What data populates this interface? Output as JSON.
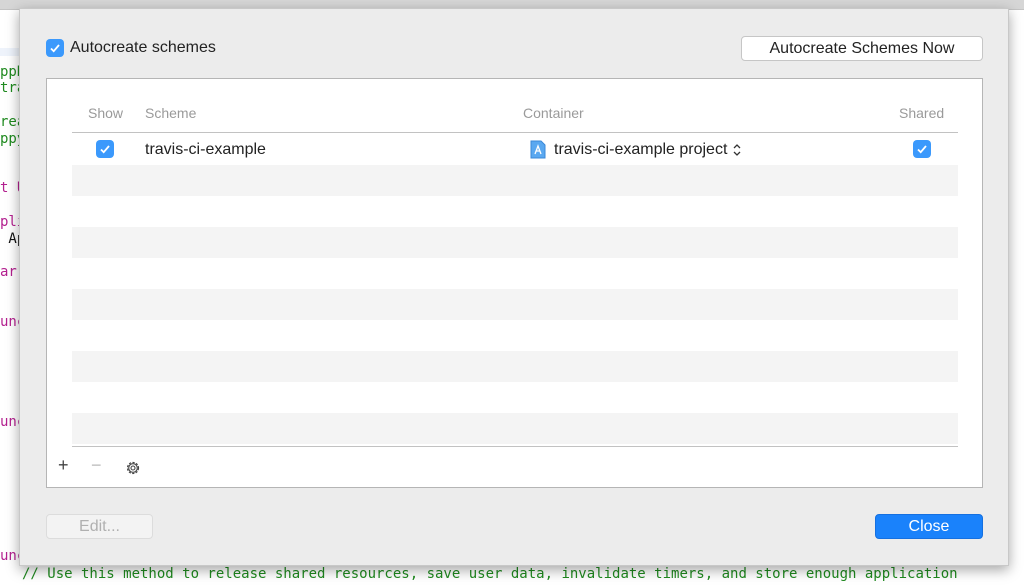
{
  "background_code": {
    "lines": [
      "ppD",
      "trav",
      "rea",
      "ppy",
      "t U",
      "pli",
      " Ap",
      "ar",
      "unc",
      "unc",
      "unc"
    ],
    "comment": "// Use this method to release shared resources, save user data, invalidate timers, and store enough application"
  },
  "sheet": {
    "autocreate_label": "Autocreate schemes",
    "autocreate_checked": true,
    "autocreate_now_button": "Autocreate Schemes Now",
    "table": {
      "headers": {
        "show": "Show",
        "scheme": "Scheme",
        "container": "Container",
        "shared": "Shared"
      },
      "rows": [
        {
          "show": true,
          "scheme": "travis-ci-example",
          "container": "travis-ci-example project",
          "shared": true
        }
      ]
    },
    "toolbar": {
      "add": "+",
      "remove": "−"
    },
    "edit_button": "Edit...",
    "close_button": "Close"
  },
  "colors": {
    "accent": "#3b99fc",
    "close_button": "#1a82fb"
  }
}
